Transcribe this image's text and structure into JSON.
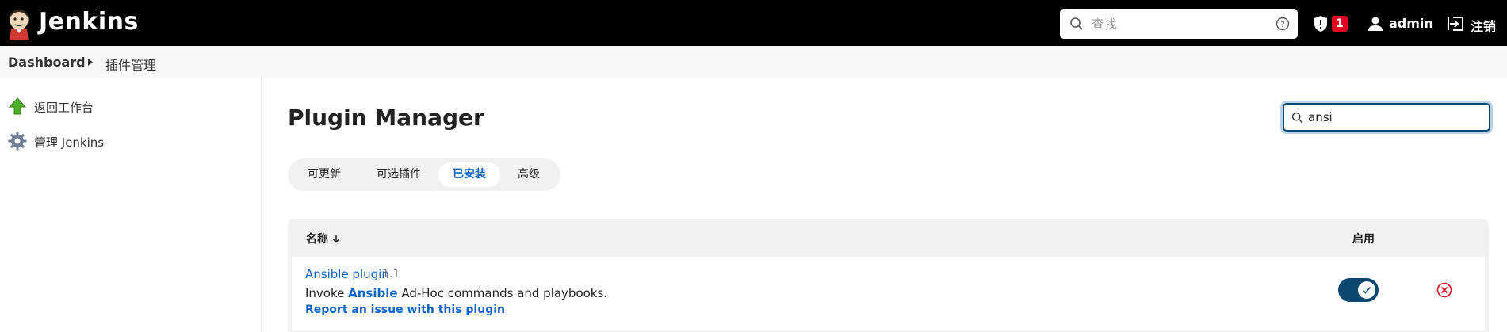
{
  "header": {
    "brand": "Jenkins",
    "search_placeholder": "查找",
    "security_alert_count": "1",
    "user": "admin",
    "logout": "注销"
  },
  "breadcrumb": {
    "items": [
      "Dashboard",
      "插件管理"
    ]
  },
  "sidebar": {
    "items": [
      {
        "label": "返回工作台",
        "icon": "up-arrow-icon"
      },
      {
        "label": "管理 Jenkins",
        "icon": "gear-icon"
      }
    ]
  },
  "main": {
    "title": "Plugin Manager",
    "filter_value": "ansi",
    "tabs": [
      {
        "label": "可更新",
        "active": false
      },
      {
        "label": "可选插件",
        "active": false
      },
      {
        "label": "已安装",
        "active": true
      },
      {
        "label": "高级",
        "active": false
      }
    ],
    "table": {
      "col_name": "名称",
      "col_name_sort": "↓",
      "col_enabled": "启用",
      "rows": [
        {
          "name": "Ansible plugin",
          "version": "1.1",
          "desc_prefix": "Invoke ",
          "desc_highlight": "Ansible",
          "desc_suffix": " Ad-Hoc commands and playbooks.",
          "report_link": "Report an issue with this plugin",
          "enabled": true
        }
      ]
    }
  },
  "colors": {
    "header_bg": "#000000",
    "accent": "#0b62c4",
    "toggle_on": "#0b4870",
    "danger": "#e6001f"
  }
}
